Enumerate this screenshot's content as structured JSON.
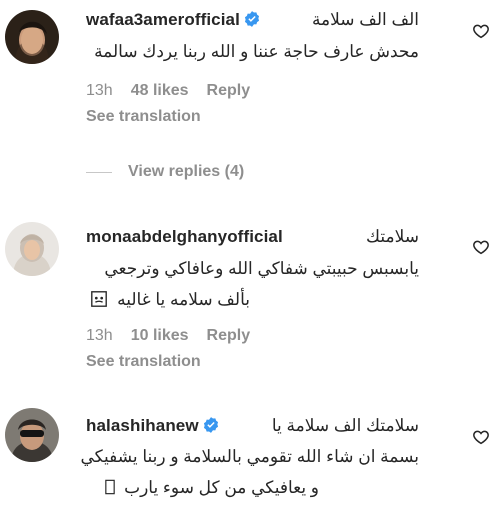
{
  "colors": {
    "primary_text": "#262626",
    "secondary_text": "#8e8e8e",
    "verified_blue": "#3897f0",
    "background": "#ffffff"
  },
  "comments": [
    {
      "username": "wafaa3amerofficial",
      "verified": true,
      "inline_text": "الف الف سلامة",
      "lines": [
        "محدش عارف حاجة عننا و الله ربنا يردك سالمة"
      ],
      "time": "13h",
      "likes": "48 likes",
      "reply_label": "Reply",
      "see_translation": "See translation",
      "like_icon": "heart-outline-icon"
    },
    {
      "username": "monaabdelghanyofficial",
      "verified": false,
      "inline_text": "سلامتك",
      "lines": [
        "يابسبس حبيبتي شفاكي الله وعافاكي وترجعي",
        "بألف سلامه يا غاليه"
      ],
      "time": "13h",
      "likes": "10 likes",
      "reply_label": "Reply",
      "see_translation": "See translation",
      "like_icon": "heart-outline-icon"
    },
    {
      "username": "halashihanew",
      "verified": true,
      "inline_text": "سلامتك الف سلامة يا",
      "lines": [
        "بسمة ان شاء الله تقومي بالسلامة و ربنا يشفيكي",
        "و يعافيكي من كل سوء يارب"
      ],
      "like_icon": "heart-outline-icon"
    }
  ],
  "view_replies": "View replies (4)"
}
